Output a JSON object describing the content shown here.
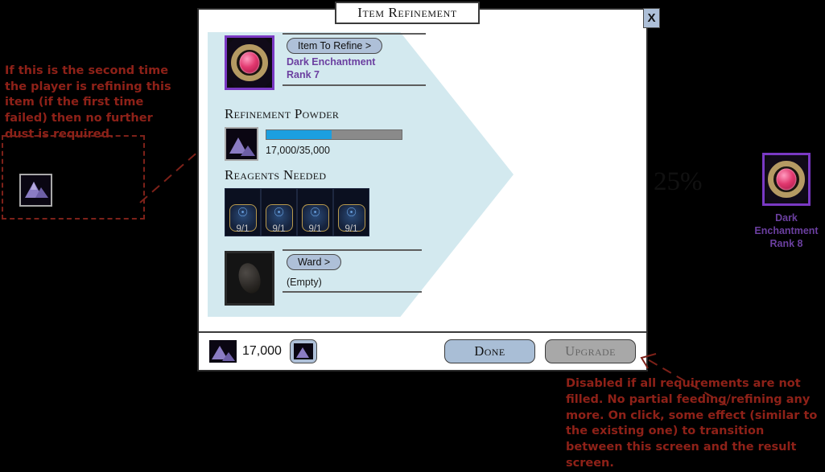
{
  "dialog": {
    "title": "Item Refinement",
    "close_label": "X"
  },
  "item_to_refine": {
    "button_label": "Item To Refine >",
    "name_line1": "Dark Enchantment",
    "name_line2": "Rank 7"
  },
  "powder": {
    "heading": "Refinement Powder",
    "current": "17,000",
    "required": "35,000",
    "progress_label": "17,000/35,000",
    "fill_percent": 48,
    "bar_fill_color": "#1c9fe0",
    "bar_track_color": "#8a8a8a"
  },
  "reagents": {
    "heading": "Reagents Needed",
    "slots": [
      {
        "count_label": "9/1"
      },
      {
        "count_label": "9/1"
      },
      {
        "count_label": "9/1"
      },
      {
        "count_label": "9/1"
      }
    ]
  },
  "ward": {
    "button_label": "Ward >",
    "status": "(Empty)"
  },
  "chance": {
    "percent_label": "25%"
  },
  "result": {
    "name_line1": "Dark Enchantment",
    "name_line2": "Rank 8"
  },
  "footer": {
    "currency_amount": "17,000",
    "done_label": "Done",
    "upgrade_label": "Upgrade"
  },
  "annotations": {
    "left": "If this is the second time the player is refining this item (if the first time failed) then no further dust is required.",
    "right": "Disabled if all requirements are not filled. No partial feeding/refining any more. On click, some effect (similar to the existing one) to transition between this screen and the result screen.",
    "color": "#8e2118"
  }
}
